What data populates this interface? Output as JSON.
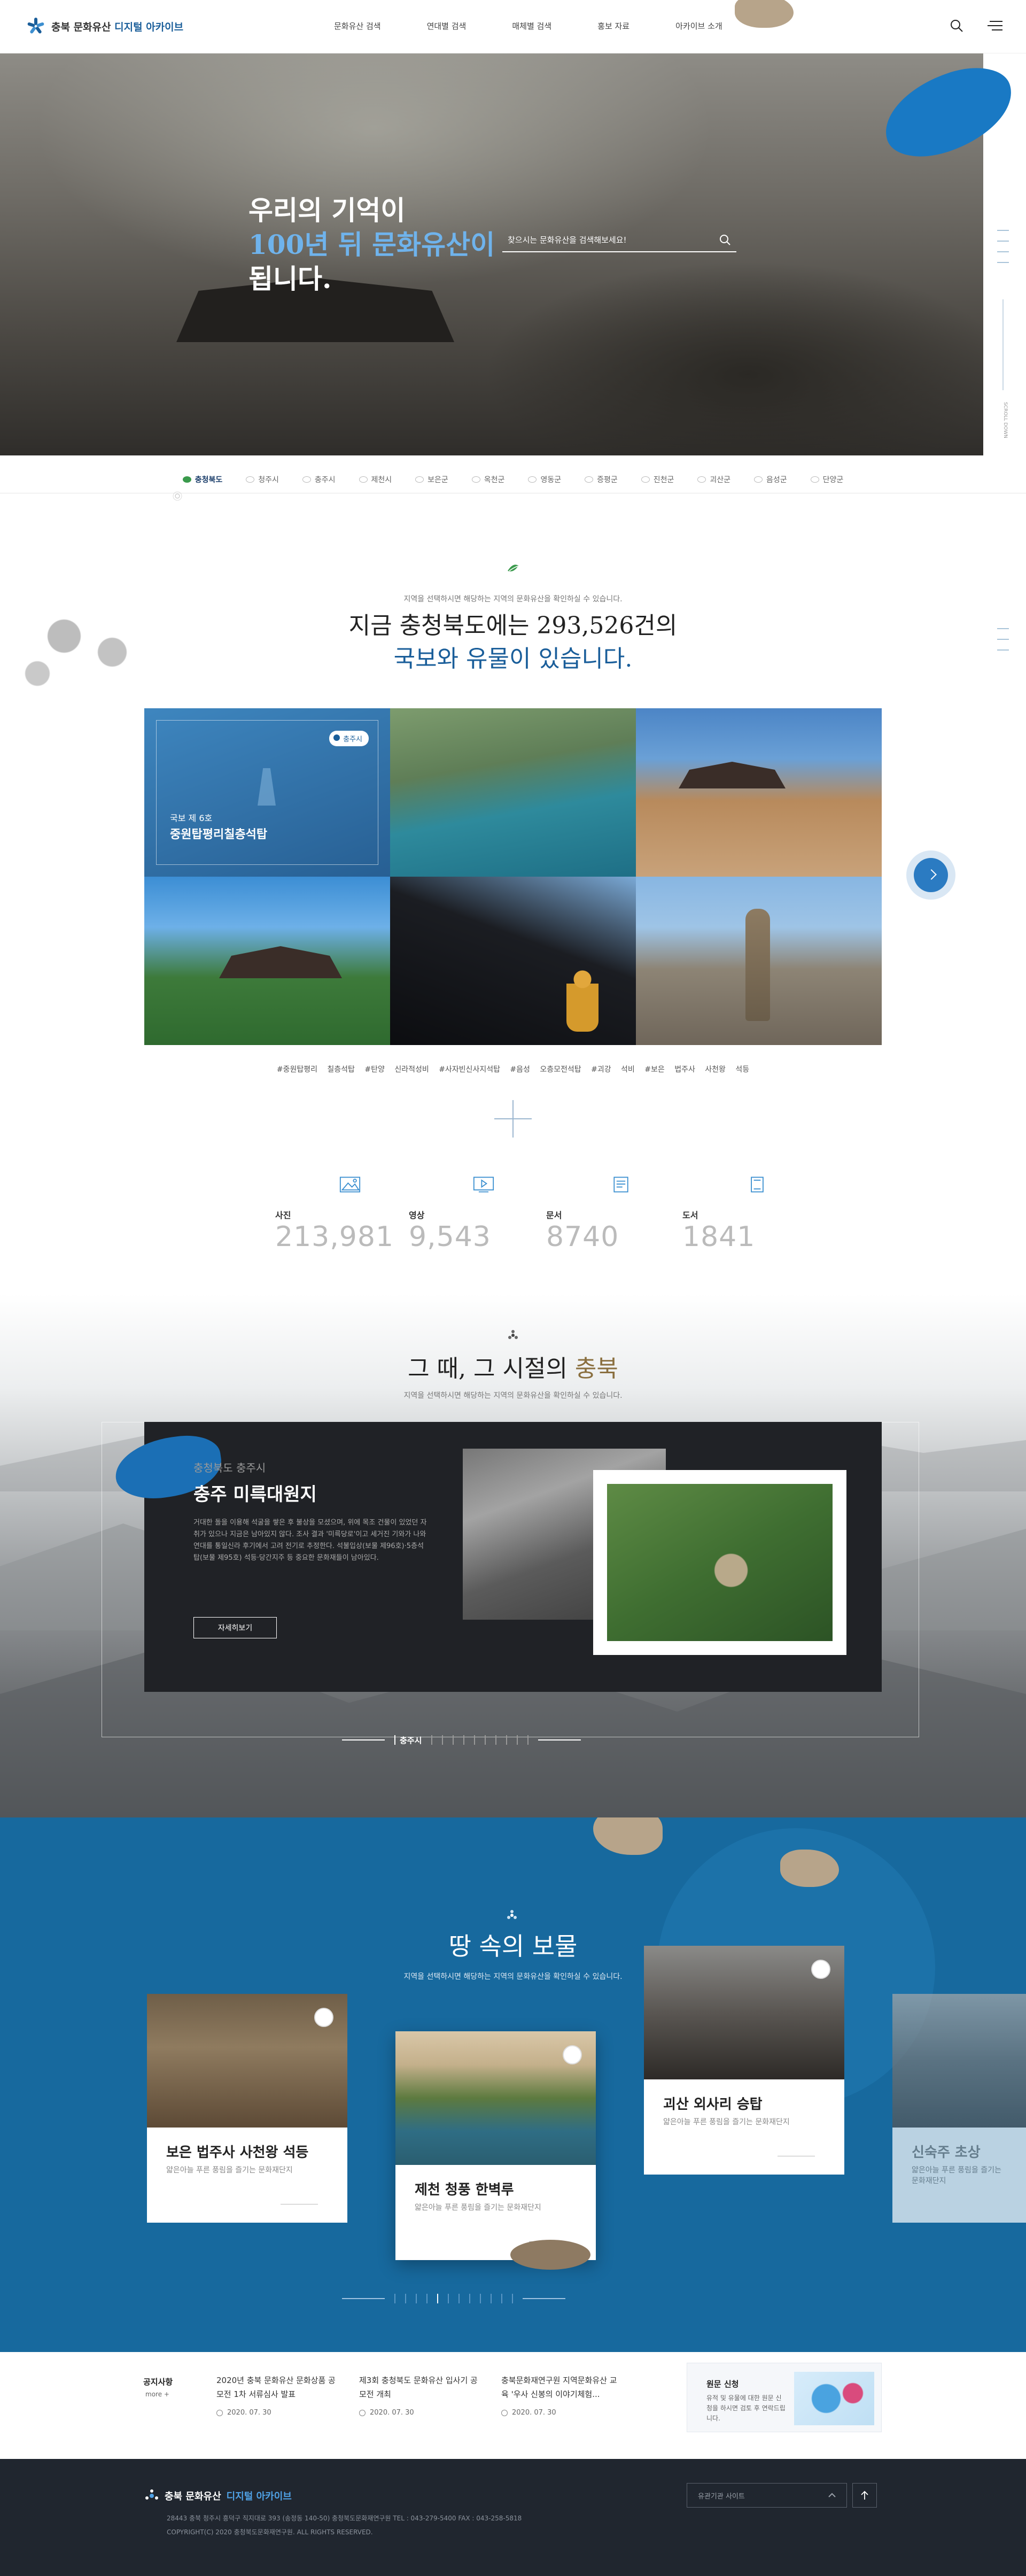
{
  "header": {
    "logo_prefix": "충북 문화유산",
    "logo_highlight": "디지털 아카이브",
    "nav": [
      "문화유산 검색",
      "연대별 검색",
      "매체별 검색",
      "홍보 자료",
      "아카이브 소개"
    ]
  },
  "hero": {
    "line1": "우리의 기억이",
    "line2": "100년 뒤 문화유산이",
    "line3": "됩니다.",
    "search_placeholder": "찾으시는 문화유산을 검색해보세요!",
    "side_caption": "SCROLL DOWN"
  },
  "regions": [
    "충청북도",
    "청주시",
    "충주시",
    "제천시",
    "보은군",
    "옥천군",
    "영동군",
    "증평군",
    "진천군",
    "괴산군",
    "음성군",
    "단양군"
  ],
  "intro": {
    "caption": "지역을 선택하시면 해당하는 지역의 문화유산을 확인하실 수 있습니다.",
    "title_line1": "지금 충청북도에는 293,526건의",
    "title_line2": "국보와 유물이 있습니다."
  },
  "gallery": {
    "featured_region": "충주시",
    "featured_sub": "국보 제 6호",
    "featured_name": "중원탑평리칠층석탑"
  },
  "hashtags": [
    "#중원탑평리 칠층석탑",
    "#탄양 신라적성비",
    "#사자빈신사지석탑",
    "#음성 오층모전석탑",
    "#괴강 석비",
    "#보은 법주사 사천왕 석등"
  ],
  "stats": [
    {
      "label": "사진",
      "value": "213,981"
    },
    {
      "label": "영상",
      "value": "9,543"
    },
    {
      "label": "문서",
      "value": "8740"
    },
    {
      "label": "도서",
      "value": "1841"
    }
  ],
  "era": {
    "title_plain": "그 때, 그 시절의",
    "title_highlight": "충북",
    "caption": "지역을 선택하시면 해당하는 지역의 문화유산을 확인하실 수 있습니다.",
    "card_region": "충청북도 충주시",
    "card_title": "충주 미륵대원지",
    "card_desc": "거대한 돌을 이용해 석굴을 쌓은 후 불상을 모셨으며, 위에 목조 건물이 있었던 자취가 있으나 지금은 남아있지 않다. 조사 결과 '미륵당로'이고 세거진 기와가 나와 연대를 통일신라 후기에서 고려 전기로 추정한다. 석불입상(보물 제96호)·5층석탑(보물 제95호) 석등·당간지주 등 중요한 문화재들이 남아있다.",
    "button": "자세히보기",
    "pager_current": "충주시"
  },
  "treasure": {
    "title": "땅 속의 보물",
    "caption": "지역을 선택하시면 해당하는 지역의 문화유산을 확인하실 수 있습니다.",
    "cards": [
      {
        "title": "보은 법주사 사천왕 석등",
        "desc": "얇은아늘 푸른 풍림을 즐기는 문화재단지"
      },
      {
        "title": "제천 청풍 한벽루",
        "desc": "얇은아늘 푸른 풍림을 즐기는 문화재단지"
      },
      {
        "title": "괴산 외사리 승탑",
        "desc": "얇은아늘 푸른 풍림을 즐기는 문화재단지"
      },
      {
        "title": "신숙주 초상",
        "desc": "얇은아늘 푸른 풍림을 즐기는 문화재단지"
      }
    ]
  },
  "notice": {
    "heading": "공지사항",
    "more": "more +",
    "items": [
      {
        "title": "2020년 충북 문화유산 문화상품 공모전 1차 서류심사 발표",
        "date": "2020. 07. 30"
      },
      {
        "title": "제3회 충청북도 문화유산 입사기 공모전 개최",
        "date": "2020. 07. 30"
      },
      {
        "title": "충북문화재연구원 지역문화유산 교육 '우사 신봉의 이야기체험...",
        "date": "2020. 07. 30"
      }
    ],
    "banner_title": "원문 신청",
    "banner_desc": "유적 및 유물에 대한 원문 신청을 하시면 검토 후 연락드립니다."
  },
  "footer": {
    "logo_prefix": "충북 문화유산",
    "logo_highlight": "디지털 아카이브",
    "address": "28443 충북 청주시 흥덕구 직지대로 393 (송정동 140-50) 충청북도문화재연구원 TEL : 043-279-5400 FAX : 043-258-5818",
    "copyright": "COPYRIGHT(C) 2020 충청북도문화재연구원. ALL RIGHTS RESERVED.",
    "site_select": "유관기관 사이트"
  },
  "colors": {
    "brand_blue": "#1a5e9a",
    "accent_blue": "#17699e",
    "highlight": "#6fb3ec"
  }
}
